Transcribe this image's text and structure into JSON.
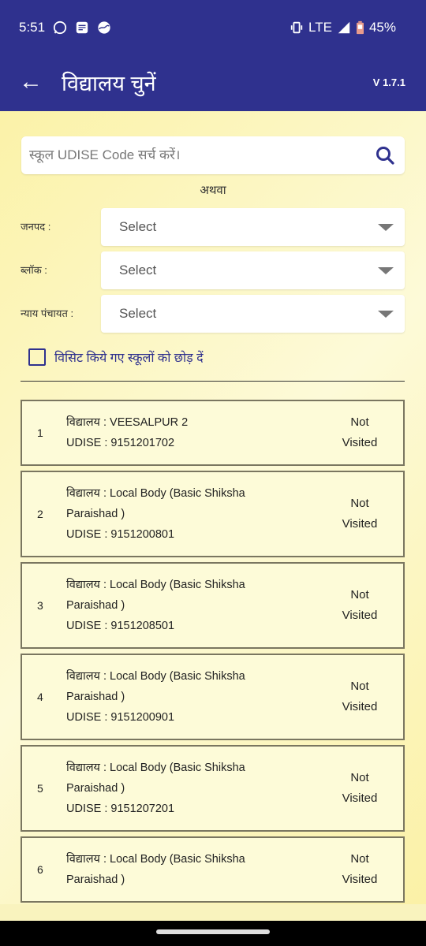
{
  "colors": {
    "appbar": "#2f318e",
    "background": "#fdf7c4",
    "card_border": "#7a7660"
  },
  "status_bar": {
    "time": "5:51",
    "network": "LTE",
    "battery": "45%",
    "icons": [
      "whatsapp-icon",
      "docs-icon",
      "weather-icon",
      "vibrate-icon",
      "signal-icon",
      "battery-low-icon"
    ]
  },
  "header": {
    "title": "विद्यालय चुनें",
    "version": "V 1.7.1"
  },
  "search": {
    "placeholder": "स्कूल UDISE Code सर्च करें।",
    "value": ""
  },
  "or_label": "अथवा",
  "filters": [
    {
      "label": "जनपद :",
      "value": "Select"
    },
    {
      "label": "ब्लॉक :",
      "value": "Select"
    },
    {
      "label": "न्याय पंचायत :",
      "value": "Select"
    }
  ],
  "skip_visited": {
    "label": "विसिट किये गए स्कूलों को छोड़ दें",
    "checked": false
  },
  "schools": [
    {
      "num": "1",
      "name": "विद्यालय : VEESALPUR 2",
      "udise": "UDISE :  9151201702",
      "status": "Not Visited"
    },
    {
      "num": "2",
      "name": "विद्यालय : Local Body (Basic Shiksha Paraishad )",
      "udise": "UDISE :  9151200801",
      "status": "Not Visited"
    },
    {
      "num": "3",
      "name": "विद्यालय : Local Body (Basic Shiksha Paraishad )",
      "udise": "UDISE :  9151208501",
      "status": "Not Visited"
    },
    {
      "num": "4",
      "name": "विद्यालय : Local Body (Basic Shiksha Paraishad )",
      "udise": "UDISE :  9151200901",
      "status": "Not Visited"
    },
    {
      "num": "5",
      "name": "विद्यालय : Local Body (Basic Shiksha Paraishad )",
      "udise": "UDISE :  9151207201",
      "status": "Not Visited"
    },
    {
      "num": "6",
      "name": "विद्यालय : Local Body (Basic Shiksha Paraishad )",
      "udise": "",
      "status": "Not Visited"
    }
  ]
}
